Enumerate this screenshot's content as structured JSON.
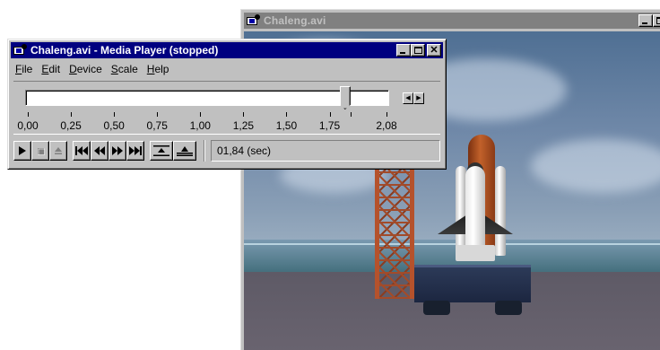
{
  "video_window": {
    "title": "Chaleng.avi"
  },
  "player": {
    "title": "Chaleng.avi - Media Player (stopped)",
    "menu": [
      {
        "label": "File",
        "mnemonic_index": 0
      },
      {
        "label": "Edit",
        "mnemonic_index": 0
      },
      {
        "label": "Device",
        "mnemonic_index": 0
      },
      {
        "label": "Scale",
        "mnemonic_index": 0
      },
      {
        "label": "Help",
        "mnemonic_index": 0
      }
    ],
    "scale": {
      "min": 0,
      "max": 2.08,
      "position": 1.84,
      "tick_labels": [
        "0,00",
        "0,25",
        "0,50",
        "0,75",
        "1,00",
        "1,25",
        "1,50",
        "1,75",
        "2,08"
      ]
    },
    "controls": {
      "play_icon": "play-icon",
      "stop_icon": "stop-icon",
      "eject_icon": "eject-icon",
      "previous_mark_icon": "previous-mark-icon",
      "rewind_icon": "rewind-icon",
      "fast_forward_icon": "fast-forward-icon",
      "next_mark_icon": "next-mark-icon",
      "start_selection_icon": "start-selection-icon",
      "end_selection_icon": "end-selection-icon"
    },
    "status": "01,84 (sec)"
  },
  "colors": {
    "titlebar_active": "#000080",
    "titlebar_inactive": "#808080",
    "face": "#c0c0c0"
  }
}
